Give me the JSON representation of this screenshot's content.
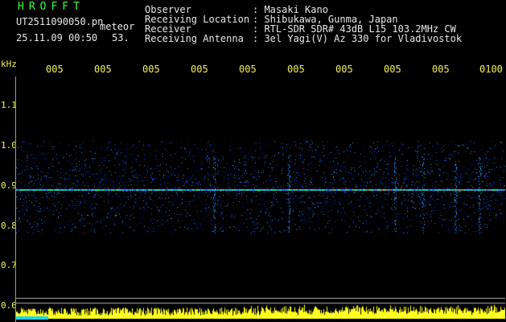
{
  "header": {
    "title": "HROFFT",
    "filename": "UT2511090050.pn",
    "file_ext": "meteor",
    "datetime": "25.11.09 00:50",
    "frame_no": "53.",
    "observer_label": "Observer",
    "observer_value": ": Masaki Kano",
    "location_label": "Receiving Location",
    "location_value": ": Shibukawa, Gunma, Japan",
    "receiver_label": "Receiver",
    "receiver_value": ": RTL-SDR SDR# 43dB L15 103.2MHz CW",
    "antenna_label": "Receiving Antenna",
    "antenna_value": ": 3el Yagi(V) Az 330 for Vladivostok"
  },
  "axis": {
    "unit": "kHz",
    "y_ticks": [
      "1.1",
      "1.0",
      "0.9",
      "0.8",
      "0.7",
      "0.6"
    ],
    "x_ticks": [
      "005",
      "005",
      "005",
      "005",
      "005",
      "005",
      "005",
      "005",
      "005",
      "0100"
    ]
  },
  "spectrogram": {
    "freq_range_khz": [
      0.6,
      1.15
    ],
    "noise_band_khz": [
      0.78,
      1.01
    ],
    "carrier_khz": 0.89,
    "colors": {
      "background": "#000000",
      "noise_dark": "#0a1aa0",
      "noise": "#1e46ff",
      "noise_bright": "#2f9bff",
      "carrier": "#33e0a0",
      "hot": "#ff3a2a",
      "power_trace": "#ffff20",
      "power_base": "#1ad2ff"
    }
  }
}
